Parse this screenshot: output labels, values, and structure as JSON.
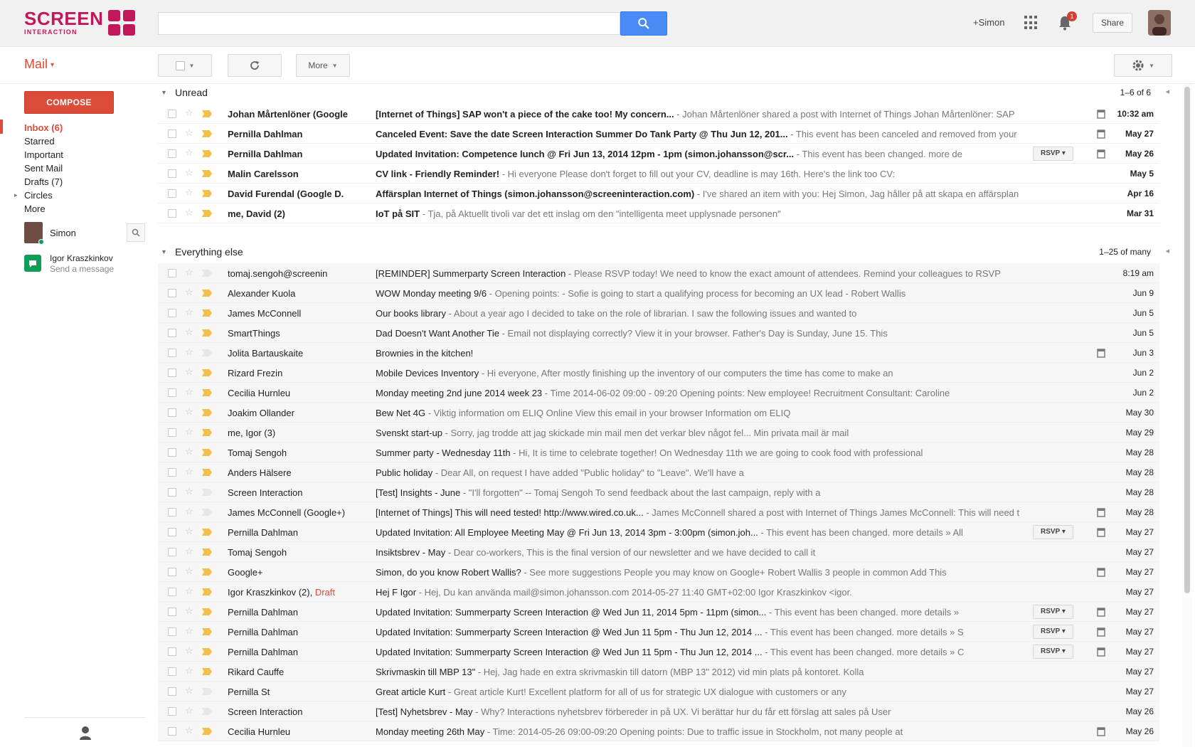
{
  "header": {
    "logo_line1": "SCREEN",
    "logo_line2": "INTERACTION",
    "search_value": "",
    "search_placeholder": "",
    "plus_name": "+Simon",
    "notification_count": "1",
    "share_label": "Share",
    "accent_color": "#dd4b39",
    "search_button_color": "#4a8af4"
  },
  "toolbar": {
    "mail_label": "Mail",
    "more_label": "More"
  },
  "sidebar": {
    "compose_label": "COMPOSE",
    "items": [
      {
        "label": "Inbox (6)",
        "active": true
      },
      {
        "label": "Starred",
        "active": false
      },
      {
        "label": "Important",
        "active": false
      },
      {
        "label": "Sent Mail",
        "active": false
      },
      {
        "label": "Drafts (7)",
        "active": false
      },
      {
        "label": "Circles",
        "active": false
      },
      {
        "label": "More",
        "active": false
      }
    ],
    "chat_me": "Simon",
    "contact_name": "Igor Kraszkinkov",
    "contact_sub": "Send a message"
  },
  "unread_section": {
    "title": "Unread",
    "count": "1–6 of 6"
  },
  "everything_section": {
    "title": "Everything else",
    "count": "1–25 of many"
  },
  "unread_rows": [
    {
      "sender": "Johan Mårtenlöner (Google",
      "subject": "[Internet of Things] SAP won't a piece of the cake too! My concern...",
      "snippet": " - Johan Mårtenlöner shared a post with Internet of Things Johan Mårtenlöner: SAP",
      "date": "10:32 am",
      "important": true,
      "attachment": true,
      "rsvp": ""
    },
    {
      "sender": "Pernilla Dahlman",
      "subject": "Canceled Event: Save the date Screen Interaction Summer Do Tank Party @ Thu Jun 12, 201...",
      "snippet": " - This event has been canceled and removed from your",
      "date": "May 27",
      "important": true,
      "attachment": true,
      "rsvp": ""
    },
    {
      "sender": "Pernilla Dahlman",
      "subject": "Updated Invitation: Competence lunch @ Fri Jun 13, 2014 12pm - 1pm (simon.johansson@scr...",
      "snippet": " - This event has been changed. more de",
      "date": "May 26",
      "important": true,
      "attachment": true,
      "rsvp": "RSVP"
    },
    {
      "sender": "Malin Carelsson",
      "subject": "CV link - Friendly Reminder!",
      "snippet": " - Hi everyone Please don't forget to fill out your CV, deadline is may 16th. Here's the link too CV:",
      "date": "May 5",
      "important": true,
      "attachment": false,
      "rsvp": ""
    },
    {
      "sender": "David Furendal (Google D.",
      "subject": "Affärsplan Internet of Things (simon.johansson@screeninteraction.com)",
      "snippet": " - I've shared an item with you: Hej Simon, Jag håller på att skapa en affärsplan",
      "date": "Apr 16",
      "important": true,
      "attachment": false,
      "rsvp": ""
    },
    {
      "sender": "me, David (2)",
      "subject": "IoT på SIT",
      "snippet": " - Tja, på Aktuellt tivoli var det ett inslag om den \"intelligenta meet upplysnade personen\"",
      "date": "Mar 31",
      "important": true,
      "attachment": false,
      "rsvp": ""
    }
  ],
  "other_rows": [
    {
      "sender": "tomaj.sengoh@screenin",
      "subject": "[REMINDER] Summerparty Screen Interaction",
      "snippet": " - Please RSVP today! We need to know the exact amount of attendees. Remind your colleagues to RSVP",
      "date": "8:19 am",
      "important": false,
      "attachment": false,
      "rsvp": ""
    },
    {
      "sender": "Alexander Kuola",
      "subject": "WOW Monday meeting 9/6",
      "snippet": " - Opening points: - Sofie is going to start a qualifying process for becoming an UX lead - Robert Wallis",
      "date": "Jun 9",
      "important": true,
      "attachment": false,
      "rsvp": ""
    },
    {
      "sender": "James McConnell",
      "subject": "Our books library",
      "snippet": " - About a year ago I decided to take on the role of librarian. I saw the following issues and wanted to",
      "date": "Jun 5",
      "important": true,
      "attachment": false,
      "rsvp": ""
    },
    {
      "sender": "SmartThings",
      "subject": "Dad Doesn't Want Another Tie",
      "snippet": " - Email not displaying correctly? View it in your browser. Father's Day is Sunday, June 15. This",
      "date": "Jun 5",
      "important": true,
      "attachment": false,
      "rsvp": ""
    },
    {
      "sender": "Jolita Bartauskaite",
      "subject": "Brownies in the kitchen!",
      "snippet": "",
      "date": "Jun 3",
      "important": false,
      "attachment": true,
      "rsvp": ""
    },
    {
      "sender": "Rizard Frezin",
      "subject": "Mobile Devices Inventory",
      "snippet": " - Hi everyone, After mostly finishing up the inventory of our computers the time has come to make an",
      "date": "Jun 2",
      "important": true,
      "attachment": false,
      "rsvp": ""
    },
    {
      "sender": "Cecilia Hurnleu",
      "subject": "Monday meeting 2nd june 2014 week 23",
      "snippet": " - Time 2014-06-02 09:00 - 09:20 Opening points: New employee! Recruitment Consultant: Caroline",
      "date": "Jun 2",
      "important": true,
      "attachment": false,
      "rsvp": ""
    },
    {
      "sender": "Joakim Ollander",
      "subject": "Bew Net 4G",
      "snippet": " - Viktig information om ELIQ Online View this email in your browser Information om ELIQ",
      "date": "May 30",
      "important": true,
      "attachment": false,
      "rsvp": ""
    },
    {
      "sender": "me, Igor (3)",
      "subject": "Svenskt start-up",
      "snippet": " - Sorry, jag trodde att jag skickade min mail men det verkar blev något fel... Min privata mail är mail",
      "date": "May 29",
      "important": true,
      "attachment": false,
      "rsvp": ""
    },
    {
      "sender": "Tomaj Sengoh",
      "subject": "Summer party - Wednesday 11th",
      "snippet": " - Hi, It is time to celebrate together! On Wednesday 11th we are going to cook food with professional",
      "date": "May 28",
      "important": true,
      "attachment": false,
      "rsvp": ""
    },
    {
      "sender": "Anders Hälsere",
      "subject": "Public holiday",
      "snippet": " - Dear All, on request I have added \"Public holiday\" to \"Leave\". We'll have a",
      "date": "May 28",
      "important": true,
      "attachment": false,
      "rsvp": ""
    },
    {
      "sender": "Screen Interaction",
      "subject": "[Test] Insights - June",
      "snippet": " - \"I'll forgotten\" -- Tomaj Sengoh To send feedback about the last campaign, reply with a",
      "date": "May 28",
      "important": false,
      "attachment": false,
      "rsvp": ""
    },
    {
      "sender": "James McConnell (Google+)",
      "subject": "[Internet of Things] This will need tested! http://www.wired.co.uk...",
      "snippet": " - James McConnell shared a post with Internet of Things James McConnell: This will need t",
      "date": "May 28",
      "important": false,
      "attachment": true,
      "rsvp": ""
    },
    {
      "sender": "Pernilla Dahlman",
      "subject": "Updated Invitation: All Employee Meeting May @ Fri Jun 13, 2014 3pm - 3:00pm (simon.joh...",
      "snippet": " - This event has been changed. more details » All",
      "date": "May 27",
      "important": true,
      "attachment": true,
      "rsvp": "RSVP"
    },
    {
      "sender": "Tomaj Sengoh",
      "subject": "Insiktsbrev - May",
      "snippet": " - Dear co-workers, This is the final version of our newsletter and we have decided to call it",
      "date": "May 27",
      "important": true,
      "attachment": false,
      "rsvp": ""
    },
    {
      "sender": "Google+",
      "subject": "Simon, do you know Robert Wallis?",
      "snippet": " - See more suggestions People you may know on Google+ Robert Wallis 3 people in common Add This",
      "date": "May 27",
      "important": true,
      "attachment": true,
      "rsvp": ""
    },
    {
      "sender": "Igor Kraszkinkov (2), Draft",
      "subject": "Hej F Igor",
      "snippet": " - Hej, Du kan använda mail@simon.johansson.com 2014-05-27 11:40 GMT+02:00 Igor Kraszkinkov <igor.",
      "date": "May 27",
      "important": true,
      "attachment": false,
      "rsvp": ""
    },
    {
      "sender": "Pernilla Dahlman",
      "subject": "Updated Invitation: Summerparty Screen Interaction @ Wed Jun 11, 2014 5pm - 11pm (simon...",
      "snippet": " - This event has been changed. more details »",
      "date": "May 27",
      "important": true,
      "attachment": true,
      "rsvp": "RSVP"
    },
    {
      "sender": "Pernilla Dahlman",
      "subject": "Updated Invitation: Summerparty Screen Interaction @ Wed Jun 11 5pm - Thu Jun 12, 2014 ...",
      "snippet": " - This event has been changed. more details » S",
      "date": "May 27",
      "important": true,
      "attachment": true,
      "rsvp": "RSVP"
    },
    {
      "sender": "Pernilla Dahlman",
      "subject": "Updated Invitation: Summerparty Screen Interaction @ Wed Jun 11 5pm - Thu Jun 12, 2014 ...",
      "snippet": " - This event has been changed. more details » C",
      "date": "May 27",
      "important": true,
      "attachment": true,
      "rsvp": "RSVP"
    },
    {
      "sender": "Rikard Cauffe",
      "subject": "Skrivmaskin till MBP 13\"",
      "snippet": " - Hej, Jag hade en extra skrivmaskin till datorn (MBP 13\" 2012) vid min plats på kontoret. Kolla",
      "date": "May 27",
      "important": true,
      "attachment": false,
      "rsvp": ""
    },
    {
      "sender": "Pernilla St",
      "subject": "Great article Kurt",
      "snippet": " - Great article Kurt! Excellent platform for all of us for strategic UX dialogue with customers or any",
      "date": "May 27",
      "important": false,
      "attachment": false,
      "rsvp": ""
    },
    {
      "sender": "Screen Interaction",
      "subject": "[Test] Nyhetsbrev - May",
      "snippet": " - Why? Interactions nyhetsbrev förbereder in på UX. Vi berättar hur du får ett förslag att sales på User",
      "date": "May 26",
      "important": false,
      "attachment": false,
      "rsvp": ""
    },
    {
      "sender": "Cecilia Hurnleu",
      "subject": "Monday meeting 26th May",
      "snippet": " - Time: 2014-05-26 09:00-09:20 Opening points: Due to traffic issue in Stockholm, not many people at",
      "date": "May 26",
      "important": true,
      "attachment": true,
      "rsvp": ""
    }
  ]
}
